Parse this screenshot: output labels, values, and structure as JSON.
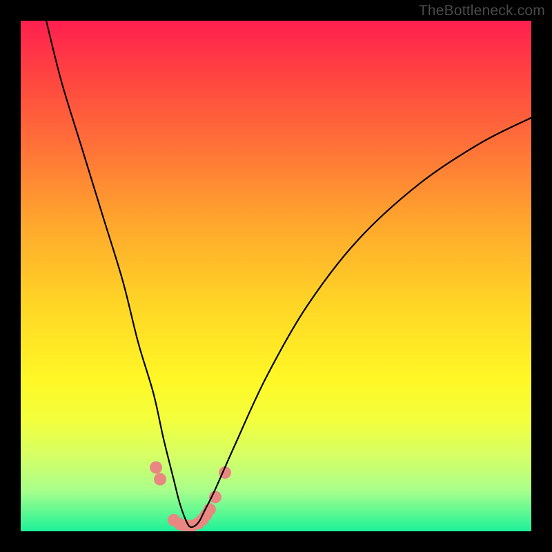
{
  "watermark": "TheBottleneck.com",
  "chart_data": {
    "type": "line",
    "title": "",
    "xlabel": "",
    "ylabel": "",
    "xlim": [
      0,
      100
    ],
    "ylim": [
      0,
      100
    ],
    "grid": false,
    "legend": false,
    "series": [
      {
        "name": "bottleneck-curve",
        "x": [
          5,
          8,
          12,
          16,
          20,
          23,
          26,
          28,
          30,
          31,
          32,
          33,
          34,
          35,
          36,
          38,
          42,
          48,
          56,
          66,
          78,
          90,
          100
        ],
        "y": [
          100,
          88,
          75,
          62,
          49,
          37,
          27,
          18,
          10,
          6,
          3,
          1,
          1,
          2,
          4,
          8,
          17,
          30,
          44,
          57,
          68,
          76,
          81
        ]
      }
    ],
    "markers": {
      "name": "highlight-dots",
      "color": "#e98782",
      "radius_px": 9,
      "points_xy": [
        [
          26.5,
          12.5
        ],
        [
          27.3,
          10.2
        ],
        [
          30.0,
          2.2
        ],
        [
          31.2,
          1.4
        ],
        [
          32.4,
          1.1
        ],
        [
          33.6,
          1.1
        ],
        [
          34.8,
          1.6
        ],
        [
          35.6,
          2.3
        ],
        [
          36.3,
          3.2
        ],
        [
          37.0,
          4.3
        ],
        [
          38.1,
          6.7
        ],
        [
          40.0,
          11.5
        ]
      ]
    }
  }
}
